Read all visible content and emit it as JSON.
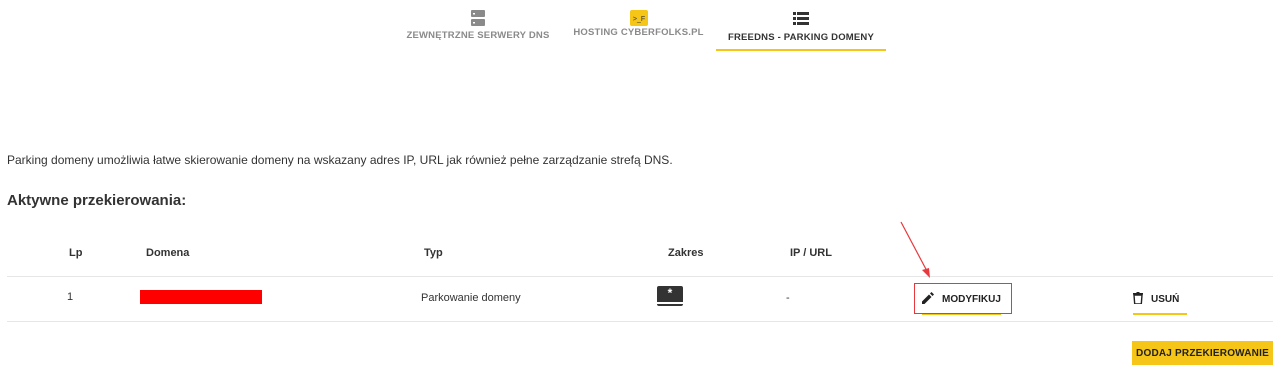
{
  "tabs": [
    {
      "label": "ZEWNĘTRZNE SERWERY DNS",
      "icon": "server-icon",
      "active": false
    },
    {
      "label": "HOSTING CYBERFOLKS.PL",
      "icon": "cyberfolks-logo-icon",
      "active": false
    },
    {
      "label": "FREEDNS - PARKING DOMENY",
      "icon": "list-icon",
      "active": true
    }
  ],
  "intro_text": "Parking domeny umożliwia łatwe skierowanie domeny na wskazany adres IP, URL jak również pełne zarządzanie strefą DNS.",
  "section_title": "Aktywne przekierowania:",
  "table": {
    "headers": {
      "lp": "Lp",
      "domena": "Domena",
      "typ": "Typ",
      "zakres": "Zakres",
      "ip_url": "IP / URL"
    },
    "rows": [
      {
        "lp": "1",
        "domena": "[redacted]",
        "typ": "Parkowanie domeny",
        "zakres": "*",
        "ip_url": "-",
        "modify_label": "MODYFIKUJ",
        "delete_label": "USUŃ"
      }
    ]
  },
  "add_button_label": "DODAJ PRZEKIEROWANIE",
  "colors": {
    "accent": "#f5c518",
    "redaction": "#ff0000",
    "annotation": "#e8383d"
  }
}
